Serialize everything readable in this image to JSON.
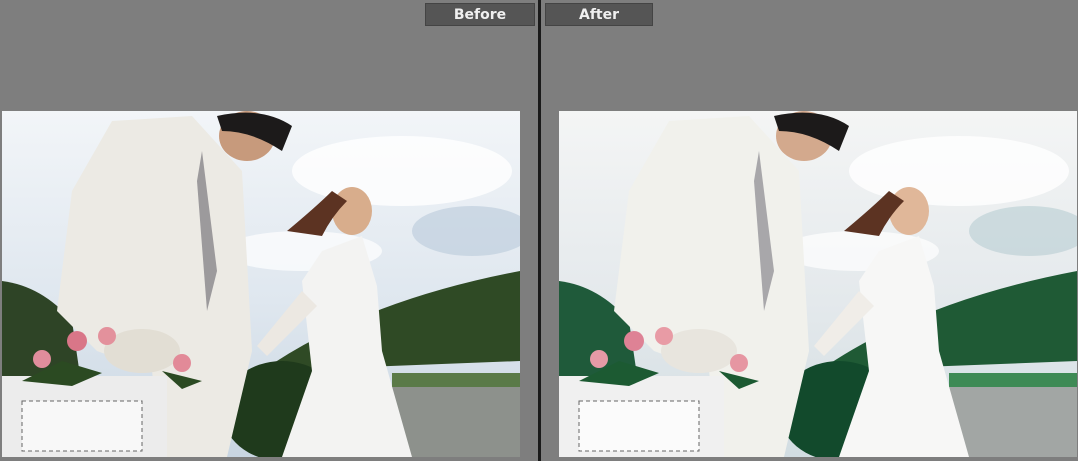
{
  "compare": {
    "before_label": "Before",
    "after_label": "After"
  },
  "colors": {
    "background": "#7e7e7e",
    "label_bg": "#555555",
    "divider": "#1a1a1a"
  }
}
